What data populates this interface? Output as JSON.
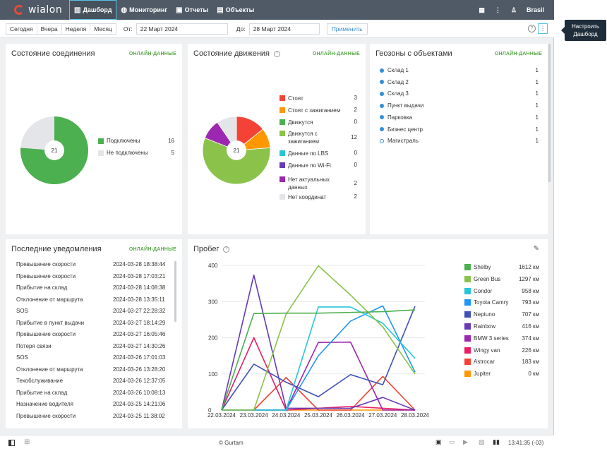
{
  "topbar": {
    "logo": "wialon",
    "nav": [
      {
        "label": "Дашборд",
        "icon": "bar-chart-icon",
        "active": true
      },
      {
        "label": "Мониторинг",
        "icon": "globe-icon"
      },
      {
        "label": "Отчеты",
        "icon": "report-icon"
      },
      {
        "label": "Объекты",
        "icon": "bus-icon"
      }
    ],
    "user": "Brasil"
  },
  "filter": {
    "periods": [
      "Сегодня",
      "Вчера",
      "Неделя",
      "Месяц"
    ],
    "from_label": "От:",
    "from_value": "22 Март 2024",
    "to_label": "До:",
    "to_value": "28 Март 2024",
    "apply": "Применить"
  },
  "tooltip": {
    "line1": "Настроить",
    "line2": "Дашборд"
  },
  "connection": {
    "title": "Состояние соединения",
    "online": "ОНЛАЙН-ДАННЫЕ",
    "total": "21",
    "items": [
      {
        "label": "Подключены",
        "value": 16,
        "color": "#4caf50"
      },
      {
        "label": "Не подключены",
        "value": 5,
        "color": "#e3e5e8"
      }
    ]
  },
  "movement": {
    "title": "Состояние движения",
    "online": "ОНЛАЙН-ДАННЫЕ",
    "total": "21",
    "items": [
      {
        "label": "Стоят",
        "value": 3,
        "color": "#f44336"
      },
      {
        "label": "Стоят с зажиганием",
        "value": 2,
        "color": "#ff9800"
      },
      {
        "label": "Движутся",
        "value": 0,
        "color": "#4caf50"
      },
      {
        "label": "Движутся с зажиганием",
        "value": 12,
        "color": "#8bc34a"
      },
      {
        "label": "Данные по LBS",
        "value": 0,
        "color": "#26c6da"
      },
      {
        "label": "Данные по Wi-Fi",
        "value": 0,
        "color": "#673ab7"
      },
      {
        "label": "Нет актуальных данных",
        "value": 2,
        "color": "#9c27b0"
      },
      {
        "label": "Нет координат",
        "value": 2,
        "color": "#e3e5e8"
      }
    ]
  },
  "geofences": {
    "title": "Геозоны с объектами",
    "online": "ОНЛАЙН-ДАННЫЕ",
    "items": [
      {
        "label": "Склад 1",
        "value": "1"
      },
      {
        "label": "Склад 2",
        "value": "1"
      },
      {
        "label": "Склад 3",
        "value": "1"
      },
      {
        "label": "Пункт выдачи",
        "value": "1"
      },
      {
        "label": "Парковка",
        "value": "1"
      },
      {
        "label": "Бизнес центр",
        "value": "1"
      },
      {
        "label": "Магистраль",
        "value": "1"
      }
    ]
  },
  "notifications": {
    "title": "Последние уведомления",
    "online": "ОНЛАЙН-ДАННЫЕ",
    "items": [
      {
        "label": "Превышение скорости",
        "time": "2024-03-28 18:38:44"
      },
      {
        "label": "Превышение скорости",
        "time": "2024-03-28 17:03:21"
      },
      {
        "label": "Прибытие на склад",
        "time": "2024-03-28 14:08:38"
      },
      {
        "label": "Отклонение от маршрута",
        "time": "2024-03-28 13:35:11"
      },
      {
        "label": "SOS",
        "time": "2024-03-27 22:28:32"
      },
      {
        "label": "Прибытие в пункт выдачи",
        "time": "2024-03-27 18:14:29"
      },
      {
        "label": "Превышение скорости",
        "time": "2024-03-27 16:05:46"
      },
      {
        "label": "Потеря связи",
        "time": "2024-03-27 14:30:26"
      },
      {
        "label": "SOS",
        "time": "2024-03-26 17:01:03"
      },
      {
        "label": "Отклонение от маршрута",
        "time": "2024-03-26 13:28:20"
      },
      {
        "label": "Техобслуживание",
        "time": "2024-03-26 12:37:05"
      },
      {
        "label": "Прибытие на склад",
        "time": "2024-03-26 10:08:13"
      },
      {
        "label": "Назначение водителя",
        "time": "2024-03-25 14:21:06"
      },
      {
        "label": "Превышение скорости",
        "time": "2024-03-25 11:38:02"
      }
    ]
  },
  "mileage": {
    "title": "Пробег",
    "unit": "км"
  },
  "chart_data": {
    "type": "line",
    "title": "Пробег",
    "x": [
      "22.03.2024",
      "23.03.2024",
      "24.03.2024",
      "25.03.2024",
      "26.03.2024",
      "27.03.2024",
      "28.03.2024"
    ],
    "ylim": [
      0,
      400
    ],
    "yticks": [
      0,
      100,
      200,
      300,
      400
    ],
    "grid": true,
    "legend": "right",
    "series": [
      {
        "name": "Shelby",
        "total": "1612 км",
        "color": "#4caf50",
        "values": [
          0,
          267,
          268,
          268,
          270,
          272,
          277
        ]
      },
      {
        "name": "Green Bus",
        "total": "1297 км",
        "color": "#8bc34a",
        "values": [
          0,
          0,
          265,
          399,
          318,
          230,
          100
        ]
      },
      {
        "name": "Condor",
        "total": "958 км",
        "color": "#26c6da",
        "values": [
          0,
          0,
          0,
          285,
          285,
          240,
          143
        ]
      },
      {
        "name": "Toyota Camry",
        "total": "793 км",
        "color": "#2196f3",
        "values": [
          0,
          0,
          0,
          150,
          246,
          288,
          105
        ]
      },
      {
        "name": "Neptuno",
        "total": "707 км",
        "color": "#3f51b5",
        "values": [
          0,
          127,
          77,
          37,
          98,
          70,
          287
        ]
      },
      {
        "name": "Rainbow",
        "total": "416 км",
        "color": "#673ab7",
        "values": [
          0,
          373,
          5,
          5,
          5,
          35,
          0
        ]
      },
      {
        "name": "BMW 3 series",
        "total": "374 км",
        "color": "#9c27b0",
        "values": [
          0,
          0,
          0,
          187,
          188,
          0,
          0
        ]
      },
      {
        "name": "Wingy van",
        "total": "226 км",
        "color": "#e91e63",
        "values": [
          0,
          200,
          0,
          5,
          10,
          5,
          0
        ]
      },
      {
        "name": "Astrocar",
        "total": "183 км",
        "color": "#f44336",
        "values": [
          0,
          0,
          90,
          0,
          0,
          93,
          0
        ]
      },
      {
        "name": "Jupiter",
        "total": "0 км",
        "color": "#ff9800",
        "values": [
          0,
          0,
          0,
          0,
          0,
          0,
          0
        ]
      }
    ]
  },
  "statusbar": {
    "copyright": "© Gurtam",
    "time": "13:41:35 (-03)"
  }
}
